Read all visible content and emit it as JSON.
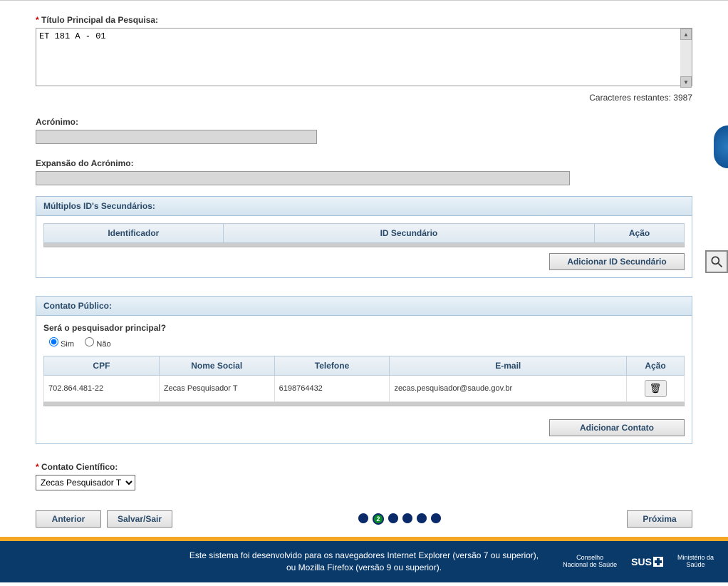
{
  "titulo": {
    "label": "Título Principal da Pesquisa:",
    "value": "ET 181 A - 01",
    "char_label": "Caracteres restantes:",
    "char_count": "3987"
  },
  "acronimo": {
    "label": "Acrónimo:",
    "value": ""
  },
  "expansao": {
    "label": "Expansão do Acrónimo:",
    "value": ""
  },
  "multiplos": {
    "title": "Múltiplos ID's Secundários:",
    "cols": {
      "identificador": "Identificador",
      "id_sec": "ID Secundário",
      "acao": "Ação"
    },
    "add_btn": "Adicionar ID Secundário"
  },
  "contato_publico": {
    "title": "Contato Público:",
    "question": "Será o pesquisador principal?",
    "sim": "Sim",
    "nao": "Não",
    "cols": {
      "cpf": "CPF",
      "nome": "Nome Social",
      "tel": "Telefone",
      "email": "E-mail",
      "acao": "Ação"
    },
    "row": {
      "cpf": "702.864.481-22",
      "nome": "Zecas Pesquisador T",
      "tel": "6198764432",
      "email": "zecas.pesquisador@saude.gov.br"
    },
    "add_btn": "Adicionar Contato"
  },
  "contato_cientifico": {
    "label": "Contato Científico:",
    "value": "Zecas Pesquisador T"
  },
  "nav": {
    "anterior": "Anterior",
    "salvar": "Salvar/Sair",
    "proxima": "Próxima",
    "current_step": "2"
  },
  "footer": {
    "line1": "Este sistema foi desenvolvido para os navegadores Internet Explorer (versão 7 ou superior),",
    "line2": "ou Mozilla Firefox (versão 9 ou superior).",
    "logo1a": "Conselho",
    "logo1b": "Nacional de Saúde",
    "logo2": "SUS",
    "logo3a": "Ministério da",
    "logo3b": "Saúde"
  }
}
